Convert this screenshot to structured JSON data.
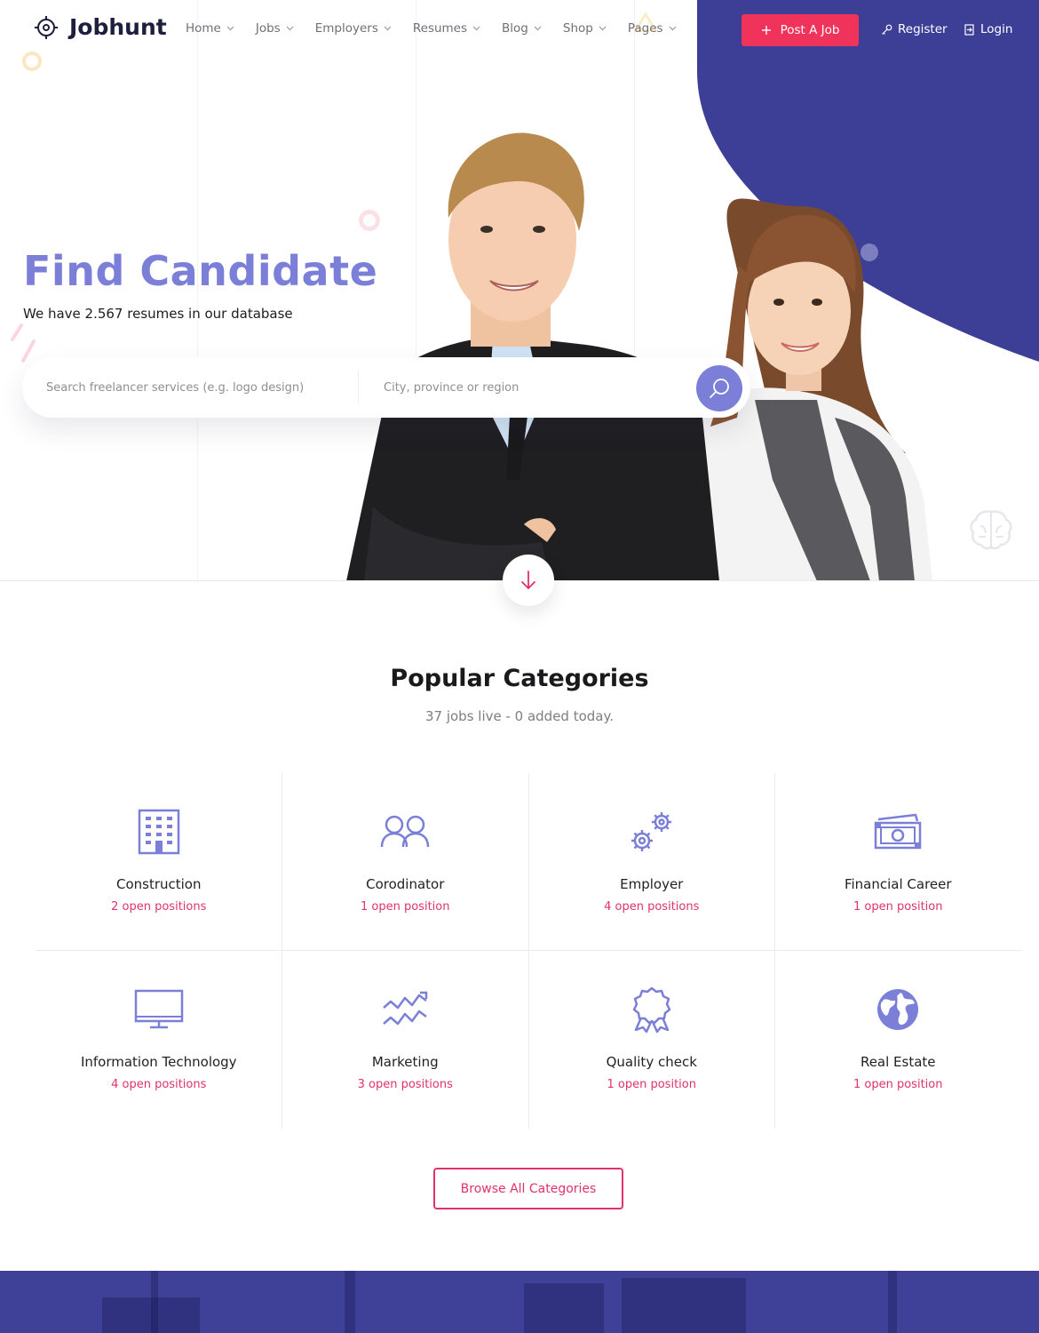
{
  "brand": {
    "name": "Jobhunt"
  },
  "nav": [
    {
      "label": "Home"
    },
    {
      "label": "Jobs"
    },
    {
      "label": "Employers"
    },
    {
      "label": "Resumes"
    },
    {
      "label": "Blog"
    },
    {
      "label": "Shop"
    },
    {
      "label": "Pages"
    }
  ],
  "header": {
    "post_job_label": "Post A Job",
    "register_label": "Register",
    "login_label": "Login"
  },
  "hero": {
    "title": "Find Candidate",
    "subtitle": "We have 2.567 resumes in our database",
    "search_placeholder": "Search freelancer services (e.g. logo design)",
    "location_placeholder": "City, province or region"
  },
  "categories_section": {
    "title": "Popular Categories",
    "subtitle": "37 jobs live - 0 added today.",
    "browse_label": "Browse All Categories",
    "items": [
      {
        "name": "Construction",
        "count": "2 open positions",
        "icon": "building-icon"
      },
      {
        "name": "Corodinator",
        "count": "1 open position",
        "icon": "users-icon"
      },
      {
        "name": "Employer",
        "count": "4 open positions",
        "icon": "gears-icon"
      },
      {
        "name": "Financial Career",
        "count": "1 open position",
        "icon": "money-icon"
      },
      {
        "name": "Information Technology",
        "count": "4 open positions",
        "icon": "monitor-icon"
      },
      {
        "name": "Marketing",
        "count": "3 open positions",
        "icon": "chart-wave-icon"
      },
      {
        "name": "Quality check",
        "count": "1 open position",
        "icon": "award-icon"
      },
      {
        "name": "Real Estate",
        "count": "1 open position",
        "icon": "globe-icon"
      }
    ]
  },
  "colors": {
    "accent_purple": "#7b7fd8",
    "brand_navy": "#3c3f95",
    "accent_pink": "#f0335a",
    "count_pink": "#e0326d"
  }
}
